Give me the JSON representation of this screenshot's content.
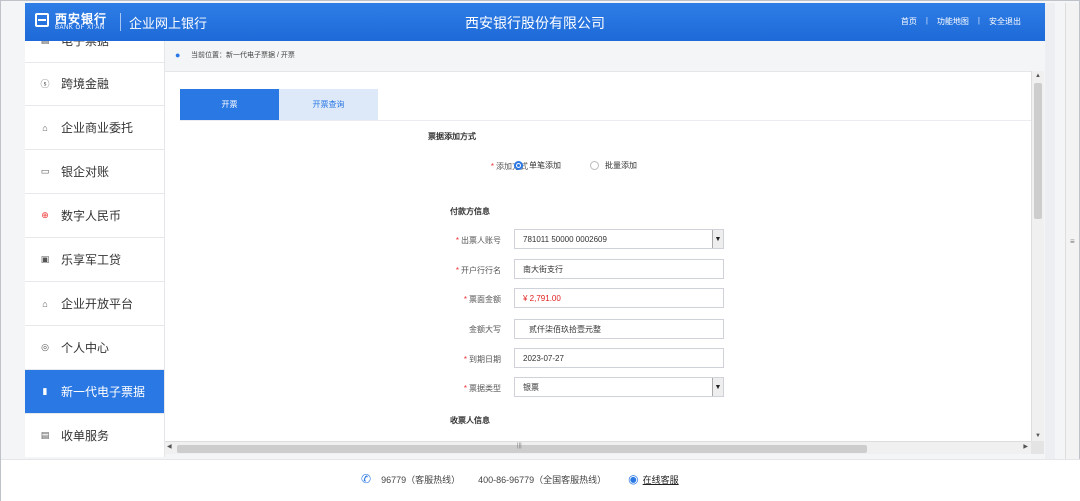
{
  "header": {
    "bank_name_cn": "西安银行",
    "bank_name_en": "BANK OF XI'AN",
    "system_title": "企业网上银行",
    "company_name": "西安银行股份有限公司",
    "links": [
      "首页",
      "功能地图",
      "安全退出"
    ]
  },
  "sidebar": {
    "items": [
      {
        "label": "电子票据",
        "icon": "document-icon",
        "active": false
      },
      {
        "label": "跨境金融",
        "icon": "dollar-circle-icon",
        "active": false
      },
      {
        "label": "企业商业委托",
        "icon": "bank-building-icon",
        "active": false
      },
      {
        "label": "银企对账",
        "icon": "chart-box-icon",
        "active": false
      },
      {
        "label": "数字人民币",
        "icon": "yuan-circle-icon",
        "active": false
      },
      {
        "label": "乐享军工贷",
        "icon": "card-icon",
        "active": false
      },
      {
        "label": "企业开放平台",
        "icon": "building-icon",
        "active": false
      },
      {
        "label": "个人中心",
        "icon": "user-circle-icon",
        "active": false
      },
      {
        "label": "新一代电子票据",
        "icon": "bill-icon",
        "active": true
      },
      {
        "label": "收单服务",
        "icon": "receipt-icon",
        "active": false
      }
    ]
  },
  "breadcrumb": {
    "text": "当前位置：新一代电子票据 / 开票"
  },
  "tabs": [
    {
      "label": "开票",
      "active": true
    },
    {
      "label": "开票查询",
      "active": false
    }
  ],
  "form": {
    "section_add_method": "票据添加方式",
    "add_method_label": "添加方式",
    "add_method_options": [
      {
        "label": "单笔添加",
        "selected": true
      },
      {
        "label": "批量添加",
        "selected": false
      }
    ],
    "section_payer": "付款方信息",
    "drawer_account_label": "出票人账号",
    "drawer_account_value": "781011 50000 0002609",
    "bank_name_label": "开户行行名",
    "bank_name_value": "南大街支行",
    "amount_label": "票面金额",
    "amount_value": "¥ 2,791.00",
    "amount_upper_label": "金额大写",
    "amount_upper_value": "贰仟柒佰玖拾壹元整",
    "due_date_label": "到期日期",
    "due_date_value": "2023-07-27",
    "bill_type_label": "票据类型",
    "bill_type_value": "银票",
    "section_payee": "收票人信息"
  },
  "footer": {
    "hotline": "96779（客服热线）",
    "national_hotline": "400-86-96779（全国客服热线）",
    "online_service": "在线客服"
  },
  "colors": {
    "brand_blue": "#2a78e4",
    "required_red": "#e33333",
    "amount_red": "#e02020"
  }
}
